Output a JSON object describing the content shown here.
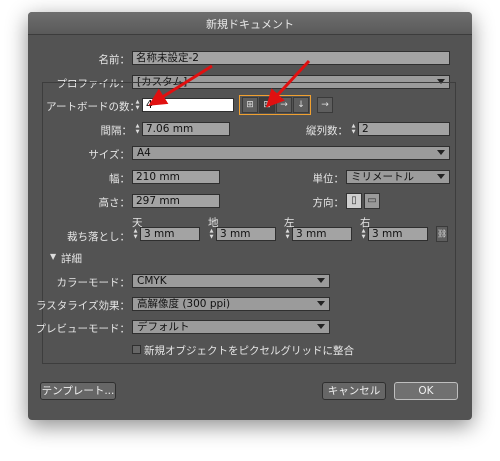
{
  "title": "新規ドキュメント",
  "name": {
    "label": "名前：",
    "value": "名称未設定-2"
  },
  "profile": {
    "label": "プロファイル：",
    "value": "[カスタム]"
  },
  "artboards": {
    "count_label": "アートボードの数：",
    "count_value": "4",
    "spacing_label": "間隔：",
    "spacing_value": "7.06 mm",
    "columns_label": "縦列数：",
    "columns_value": "2",
    "layout_icons": [
      "grid-by-row-icon",
      "grid-by-column-icon",
      "arrange-by-row-icon",
      "arrange-by-column-icon"
    ],
    "direction_icon": "right-to-left-layout-icon"
  },
  "size": {
    "label": "サイズ：",
    "value": "A4"
  },
  "width": {
    "label": "幅：",
    "value": "210 mm"
  },
  "units": {
    "label": "単位：",
    "value": "ミリメートル"
  },
  "height": {
    "label": "高さ：",
    "value": "297 mm"
  },
  "orientation": {
    "label": "方向："
  },
  "bleed": {
    "label": "裁ち落とし：",
    "top_label": "天",
    "bottom_label": "地",
    "left_label": "左",
    "right_label": "右",
    "top": "3 mm",
    "bottom": "3 mm",
    "left": "3 mm",
    "right": "3 mm"
  },
  "advanced": {
    "label": "詳細",
    "color_mode_label": "カラーモード：",
    "color_mode_value": "CMYK",
    "raster_label": "ラスタライズ効果：",
    "raster_value": "高解像度 (300 ppi)",
    "preview_label": "プレビューモード：",
    "preview_value": "デフォルト",
    "align_pixel_label": "新規オブジェクトをピクセルグリッドに整合"
  },
  "buttons": {
    "templates": "テンプレート...",
    "cancel": "キャンセル",
    "ok": "OK"
  },
  "colors": {
    "dialog": "#535353",
    "field": "#a3a3a3",
    "highlight": "#f0a030",
    "arrow": "#e01010"
  }
}
